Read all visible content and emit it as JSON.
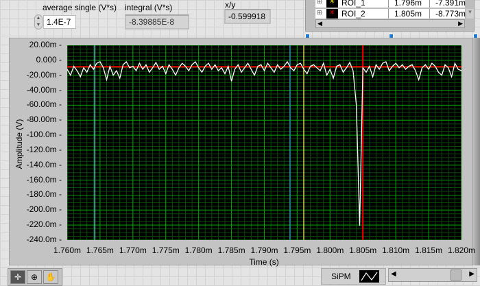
{
  "controls": {
    "average_label": "average single (V*s)",
    "average_value": "1.4E-7",
    "integral_label": "integral (V*s)",
    "integral_value": "-8.39885E-8",
    "xy_label": "x/y",
    "xy_value": "-0.599918"
  },
  "cursor_legend": {
    "rows": [
      {
        "name": "ROI_1",
        "x": "1.796m",
        "y": "-7.391m",
        "color": "#ffff00"
      },
      {
        "name": "ROI_2",
        "x": "1.805m",
        "y": "-8.773m",
        "color": "#ff0000"
      }
    ]
  },
  "plot_legend": {
    "name": "SiPM"
  },
  "colors": {
    "trace": "#ffffff",
    "grid_major": "#00a000",
    "grid_minor": "#0a4a0a",
    "plot_bg": "#000000"
  },
  "chart_data": {
    "type": "line",
    "xlabel": "Time (s)",
    "ylabel": "Amplitude (V)",
    "xlim": [
      0.00176,
      0.00182
    ],
    "ylim": [
      -0.24,
      0.02
    ],
    "x_tick_labels": [
      "1.760m",
      "1.765m",
      "1.770m",
      "1.775m",
      "1.780m",
      "1.785m",
      "1.790m",
      "1.795m",
      "1.800m",
      "1.805m",
      "1.810m",
      "1.815m",
      "1.820m"
    ],
    "y_tick_labels": [
      "20.00m",
      "0.000",
      "-20.00m",
      "-40.00m",
      "-60.00m",
      "-80.00m",
      "-100.0m",
      "-120.0m",
      "-140.0m",
      "-160.0m",
      "-180.0m",
      "-200.0m",
      "-220.0m",
      "-240.0m"
    ],
    "series": [
      {
        "name": "SiPM",
        "x_start": 0.00176,
        "dx": 5e-07,
        "values_mV": [
          -12,
          -20,
          -8,
          -14,
          -22,
          -10,
          -16,
          -6,
          -12,
          -4,
          -2,
          -10,
          -26,
          -8,
          -20,
          -14,
          -24,
          -6,
          -2,
          -10,
          -8,
          -14,
          -4,
          -12,
          -6,
          -16,
          -10,
          -3,
          -12,
          -8,
          -18,
          -6,
          -12,
          -20,
          -10,
          -4,
          -8,
          -14,
          -6,
          -2,
          -10,
          -16,
          -8,
          -4,
          -12,
          -6,
          -14,
          -10,
          -18,
          -8,
          -28,
          -12,
          -6,
          -16,
          -10,
          -4,
          -12,
          -20,
          -8,
          -6,
          -14,
          -4,
          -10,
          -16,
          -6,
          -12,
          -8,
          -2,
          -10,
          -14,
          -6,
          -4,
          -12,
          -18,
          -8,
          -6,
          -10,
          -14,
          -4,
          -20,
          -12,
          -24,
          -8,
          -6,
          -16,
          -10,
          -3,
          -14,
          -60,
          -221,
          -10,
          -16,
          -8,
          -22,
          -6,
          -12,
          -4,
          -2,
          -14,
          -8,
          -4,
          -10,
          -6,
          -12,
          -8,
          -6,
          -14,
          -26,
          -10,
          -6,
          -12,
          -4,
          -8,
          -16,
          -20,
          -6,
          -10,
          -22,
          -4,
          -12,
          -14,
          -8,
          -4,
          -10,
          -6,
          -18
        ]
      }
    ],
    "cursors": [
      {
        "x": 0.0017642,
        "color": "#80ffff"
      },
      {
        "x": 0.0017939,
        "color": "#3a9ad9"
      },
      {
        "x": 0.001796,
        "y": -0.007391,
        "color": "#ffff60",
        "name": "ROI_1"
      },
      {
        "x": 0.001805,
        "y": -0.008773,
        "color": "#ff0000",
        "name": "ROI_2",
        "horizontal": true
      }
    ],
    "grid": true
  }
}
